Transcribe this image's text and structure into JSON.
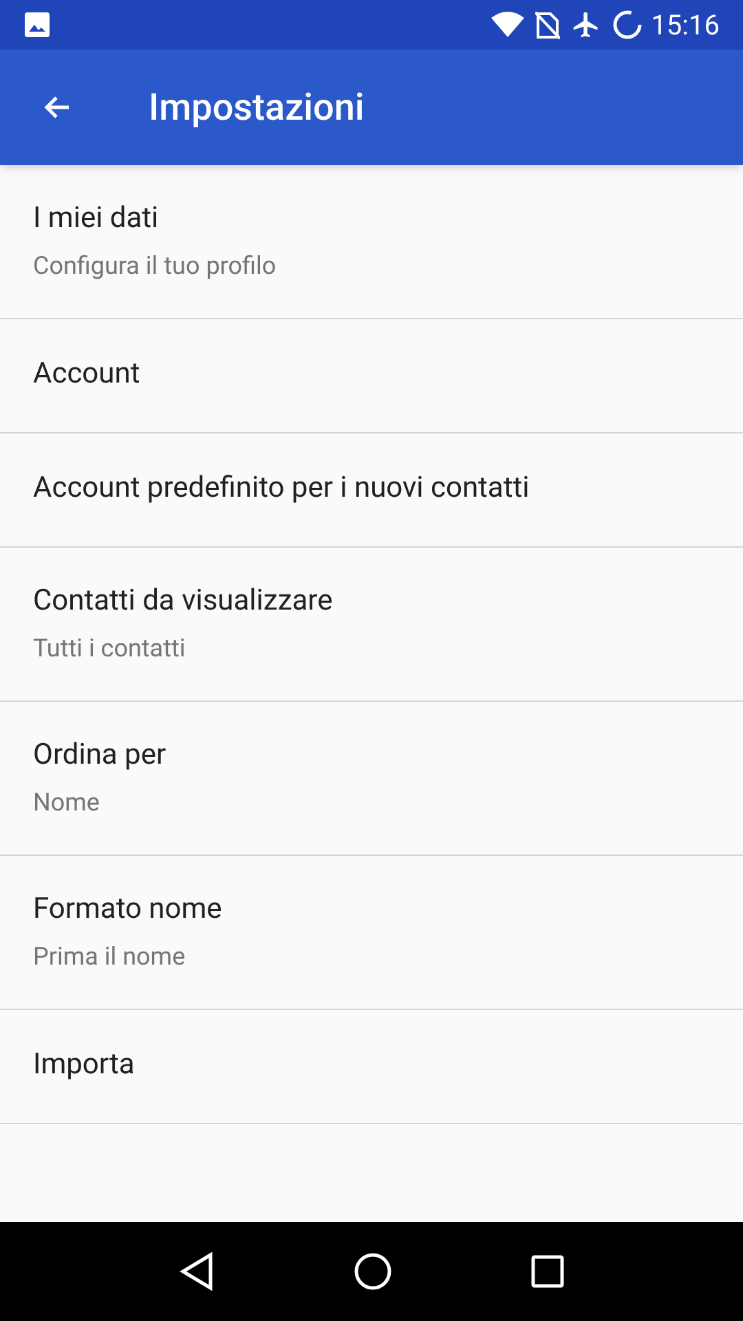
{
  "status_bar": {
    "time": "15:16"
  },
  "app_bar": {
    "title": "Impostazioni"
  },
  "settings": [
    {
      "title": "I miei dati",
      "subtitle": "Configura il tuo profilo"
    },
    {
      "title": "Account"
    },
    {
      "title": "Account predefinito per i nuovi contatti"
    },
    {
      "title": "Contatti da visualizzare",
      "subtitle": "Tutti i contatti"
    },
    {
      "title": "Ordina per",
      "subtitle": "Nome"
    },
    {
      "title": "Formato nome",
      "subtitle": "Prima il nome"
    },
    {
      "title": "Importa"
    }
  ]
}
